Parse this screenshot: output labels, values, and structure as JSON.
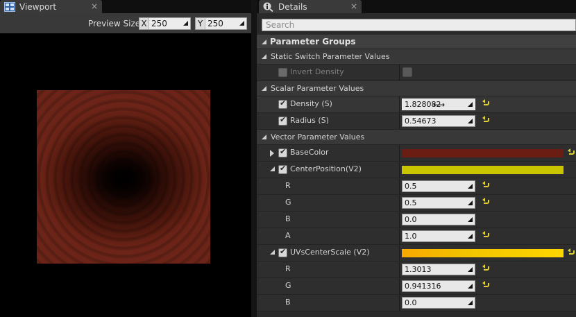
{
  "tabs": {
    "viewport": "Viewport",
    "details": "Details",
    "close_glyph": "×"
  },
  "viewport": {
    "preview_size_label": "Preview Size",
    "x_axis": "X",
    "x_value": "250",
    "y_axis": "Y",
    "y_value": "250"
  },
  "details": {
    "search_placeholder": "Search",
    "parameter_groups": "Parameter Groups",
    "static_switch_group": "Static Switch Parameter Values",
    "invert_density": "Invert Density",
    "scalar_group": "Scalar Parameter Values",
    "density_label": "Density (S)",
    "density_value": "1.828082",
    "radius_label": "Radius (S)",
    "radius_value": "0.54673",
    "vector_group": "Vector Parameter Values",
    "base_color_label": "BaseColor",
    "base_color": "#6b1d13",
    "center_position_label": "CenterPosition(V2)",
    "center_position_color": "#c9c600",
    "cp_r_label": "R",
    "cp_r_value": "0.5",
    "cp_g_label": "G",
    "cp_g_value": "0.5",
    "cp_b_label": "B",
    "cp_b_value": "0.0",
    "cp_a_label": "A",
    "cp_a_value": "1.0",
    "uvs_label": "UVsCenterScale (V2)",
    "uvs_color": "#f2c400",
    "uvs_r_label": "R",
    "uvs_r_value": "1.3013",
    "uvs_g_label": "G",
    "uvs_g_value": "0.941316",
    "uvs_b_label": "B",
    "uvs_b_value": "0.0"
  }
}
